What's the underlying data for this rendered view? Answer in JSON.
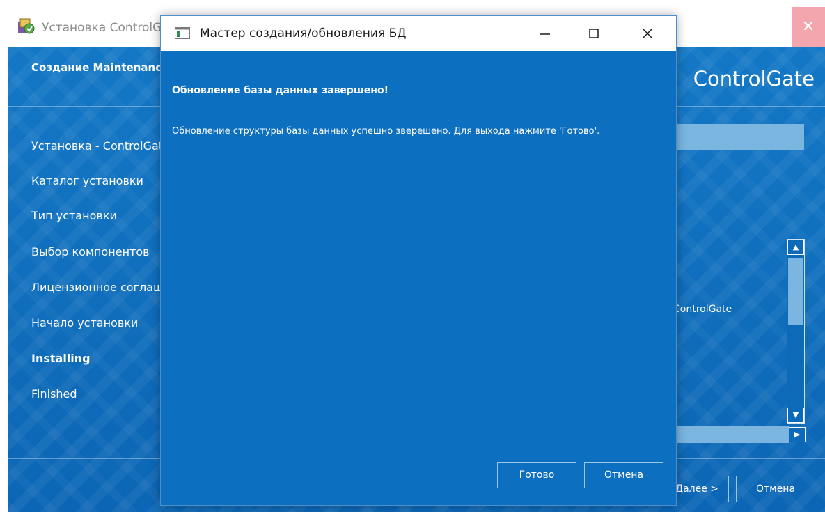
{
  "installer": {
    "title": "Установка ControlGate",
    "header_subtitle": "Создание Maintenance Tool",
    "brand": "ControlGate",
    "steps": [
      {
        "label": "Установка - ControlGate",
        "active": false
      },
      {
        "label": "Каталог установки",
        "active": false
      },
      {
        "label": "Тип установки",
        "active": false
      },
      {
        "label": "Выбор компонентов",
        "active": false
      },
      {
        "label": "Лицензионное соглашение",
        "active": false
      },
      {
        "label": "Начало установки",
        "active": false
      },
      {
        "label": "Installing",
        "active": true
      },
      {
        "label": "Finished",
        "active": false
      }
    ],
    "log_text": "ControlGate",
    "buttons": {
      "next_label": "Далее >",
      "cancel_label": "Отмена"
    },
    "colors": {
      "background": "#0c66b5",
      "close_button": "#f3a6ad",
      "progress": "#7ab6e0"
    }
  },
  "dialog": {
    "title": "Мастер создания/обновления БД",
    "heading": "Обновление базы данных завершено!",
    "message": "Обновление структуры базы данных успешно зверешено. Для выхода нажмите 'Готово'.",
    "buttons": {
      "ok_label": "Готово",
      "cancel_label": "Отмена"
    },
    "colors": {
      "background": "#0d6fc0",
      "titlebar": "#ffffff"
    }
  }
}
